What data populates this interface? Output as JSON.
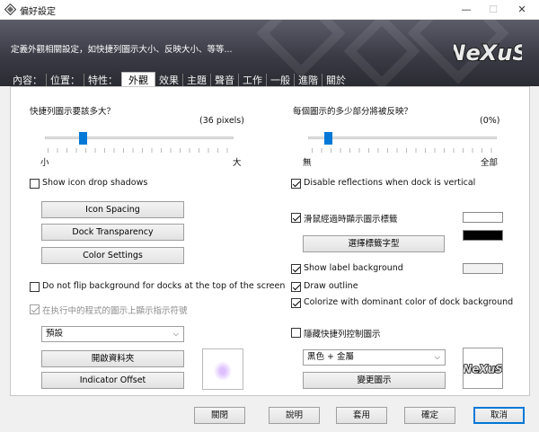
{
  "window": {
    "title": "偏好設定",
    "minimize_glyph": "—",
    "maximize_glyph": "☐",
    "close_glyph": "✕",
    "banner_description": "定義外觀相關設定，如快捷列圖示大小、反映大小、等等..."
  },
  "tabs": [
    {
      "label": "內容："
    },
    {
      "label": "位置："
    },
    {
      "label": "特性："
    },
    {
      "label": "外觀",
      "active": true
    },
    {
      "label": "效果"
    },
    {
      "label": "主題"
    },
    {
      "label": "聲音"
    },
    {
      "label": "工作"
    },
    {
      "label": "一般"
    },
    {
      "label": "進階"
    },
    {
      "label": "關於"
    }
  ],
  "left": {
    "icon_size": {
      "label": "快捷列圖示要該多大？",
      "value_text": "(36 pixels)",
      "min_label": "小",
      "max_label": "大",
      "level_fraction": 0.1
    },
    "show_icon_drop_shadows": {
      "label": "Show icon drop shadows",
      "checked": false
    },
    "icon_spacing_button": "Icon Spacing",
    "dock_transparency_button": "Dock Transparency",
    "color_settings_button": "Color Settings",
    "do_not_flip": {
      "label": "Do not flip background for docks at the top of the screen",
      "checked": false
    },
    "running_indicator": {
      "label": "在执行中的程式的圖示上顯示指示符號",
      "checked": true,
      "disabled": true
    },
    "indicator_select": {
      "value": "預設"
    },
    "open_folder_button": "開啟資料夾",
    "indicator_offset_button": "Indicator Offset"
  },
  "right": {
    "reflection": {
      "label": "每個圖示的多少部分將被反映？",
      "value_text": "(0%)",
      "min_label": "無",
      "max_label": "全部",
      "level_fraction": 0.0
    },
    "disable_reflections": {
      "label": "Disable reflections when dock is vertical",
      "checked": true
    },
    "show_label_on_hover": {
      "label": "滑鼠經過時顯示圖示標籤",
      "checked": true
    },
    "select_label_font_button": "選擇標籤字型",
    "show_label_background": {
      "label": "Show label background",
      "checked": true
    },
    "draw_outline": {
      "label": "Draw outline",
      "checked": true
    },
    "colorize_dominant": {
      "label": "Colorize with dominant color of dock background",
      "checked": true
    },
    "hide_dock_control_icons": {
      "label": "隱藏快捷列控制圖示",
      "checked": false
    },
    "control_icon_select": {
      "value": "黑色 + 金屬"
    },
    "change_icon_button": "變更圖示"
  },
  "colors": {
    "label_text_color": "#ffffff",
    "label_outline_color": "#000000",
    "label_background_color": "#f2f2f2",
    "accent": "#0078d7"
  },
  "logo_text": "NeXuS",
  "footer": {
    "close": "關閉",
    "help": "說明",
    "apply": "套用",
    "ok": "確定",
    "cancel": "取消"
  }
}
